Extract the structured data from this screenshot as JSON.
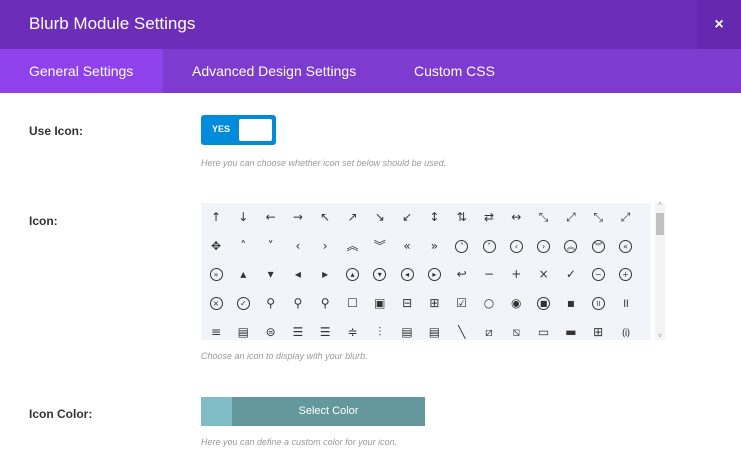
{
  "header": {
    "title": "Blurb Module Settings",
    "close": "×"
  },
  "tabs": [
    {
      "label": "General Settings",
      "active": true
    },
    {
      "label": "Advanced Design Settings"
    },
    {
      "label": "Custom CSS"
    }
  ],
  "use_icon": {
    "label": "Use Icon:",
    "toggle": "YES",
    "description": "Here you can choose whether icon set below should be used."
  },
  "icon": {
    "label": "Icon:",
    "description": "Choose an icon to display with your blurb.",
    "icons": [
      [
        "↑",
        "↓",
        "←",
        "→",
        "↖",
        "↗",
        "↘",
        "↙",
        "↕",
        "⇅",
        "⇄",
        "↔",
        "⤡",
        "⤢",
        "⤡",
        "⤢"
      ],
      [
        "✥",
        "˄",
        "˅",
        "‹",
        "›",
        "︽",
        "︾",
        "«",
        "»",
        "(˄)",
        "(˅)",
        "(‹)",
        "(›)",
        "(︽)",
        "(︾)",
        "(«)"
      ],
      [
        "(»)",
        "▴",
        "▾",
        "◂",
        "▸",
        "(▴)",
        "(▾)",
        "(◂)",
        "(▸)",
        "↩",
        "−",
        "+",
        "×",
        "✓",
        "(−)",
        "(+)"
      ],
      [
        "(×)",
        "(✓)",
        "⚲",
        "⚲",
        "⚲",
        "☐",
        "▣",
        "⊟",
        "⊞",
        "☑",
        "○",
        "◉",
        "(■)",
        "▪",
        "(॥)",
        "॥"
      ],
      [
        "≡",
        "▤",
        "⊜",
        "☰",
        "☰",
        "≑",
        "⫶",
        "▤",
        "▤",
        "╲",
        "⧄",
        "⧅",
        "▭",
        "▬",
        "⊞",
        "(i)"
      ]
    ]
  },
  "icon_color": {
    "label": "Icon Color:",
    "button": "Select Color",
    "description": "Here you can define a custom color for your icon.",
    "swatch": "#7fbcc6"
  }
}
